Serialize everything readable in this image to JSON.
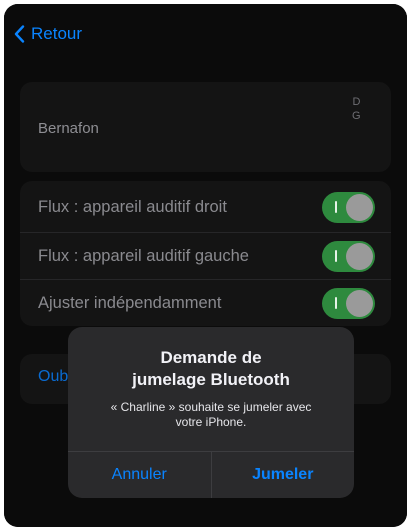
{
  "nav": {
    "back_label": "Retour"
  },
  "hearing_aid": {
    "name": "Bernafon",
    "side_right_label": "D",
    "side_left_label": "G"
  },
  "settings": {
    "rows": [
      {
        "label": "Flux : appareil auditif droit",
        "on": true
      },
      {
        "label": "Flux : appareil auditif gauche",
        "on": true
      },
      {
        "label": "Ajuster indépendamment",
        "on": true
      }
    ]
  },
  "obscured_row_text": "Oub",
  "dialog": {
    "title_line1": "Demande de",
    "title_line2": "jumelage Bluetooth",
    "message_line1": "« Charline » souhaite se jumeler avec",
    "message_line2": "votre iPhone.",
    "cancel_label": "Annuler",
    "pair_label": "Jumeler"
  },
  "colors": {
    "accent": "#0a84ff",
    "toggle_on": "#2e8a3e",
    "background": "#0b0b0b"
  },
  "icons": {
    "back": "chevron-left-icon"
  }
}
